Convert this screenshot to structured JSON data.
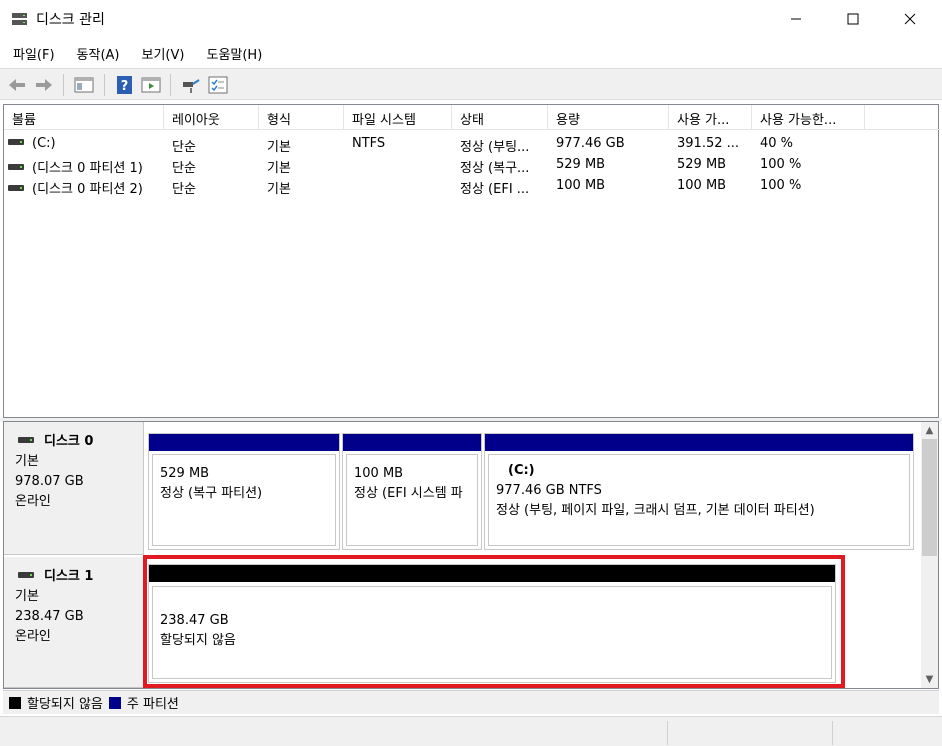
{
  "window": {
    "title": "디스크 관리",
    "minimize": "—",
    "maximize": "☐",
    "close": "✕"
  },
  "menu": [
    "파일(F)",
    "동작(A)",
    "보기(V)",
    "도움말(H)"
  ],
  "toolbar": [
    "back-icon",
    "forward-icon",
    "console-tree-icon",
    "help-icon",
    "action-pane-icon",
    "connect-icon",
    "properties-icon"
  ],
  "volume_list": {
    "columns": [
      "볼륨",
      "레이아웃",
      "형식",
      "파일 시스템",
      "상태",
      "용량",
      "사용 가...",
      "사용 가능한..."
    ],
    "rows": [
      [
        "(C:)",
        "단순",
        "기본",
        "NTFS",
        "정상 (부팅...",
        "977.46 GB",
        "391.52 ...",
        "40 %"
      ],
      [
        "(디스크 0 파티션 1)",
        "단순",
        "기본",
        "",
        "정상 (복구...",
        "529 MB",
        "529 MB",
        "100 %"
      ],
      [
        "(디스크 0 파티션 2)",
        "단순",
        "기본",
        "",
        "정상 (EFI ...",
        "100 MB",
        "100 MB",
        "100 %"
      ]
    ]
  },
  "disks": [
    {
      "name": "디스크 0",
      "type": "기본",
      "size": "978.07 GB",
      "status": "온라인",
      "partitions": [
        {
          "title": "",
          "size": "529 MB",
          "status": "정상 (복구 파티션)"
        },
        {
          "title": "",
          "size": "100 MB",
          "status": "정상 (EFI 시스템 파"
        },
        {
          "title": "(C:)",
          "size": "977.46 GB NTFS",
          "status": "정상 (부팅, 페이지 파일, 크래시 덤프, 기본 데이터 파티션)"
        }
      ]
    },
    {
      "name": "디스크 1",
      "type": "기본",
      "size": "238.47 GB",
      "status": "온라인",
      "partitions": [
        {
          "size": "238.47 GB",
          "status": "할당되지 않음"
        }
      ]
    }
  ],
  "legend": [
    {
      "label": "할당되지 않음",
      "color": "#000000"
    },
    {
      "label": "주 파티션",
      "color": "#00008b"
    }
  ],
  "scroll": {
    "up": "▲",
    "down": "▼"
  }
}
